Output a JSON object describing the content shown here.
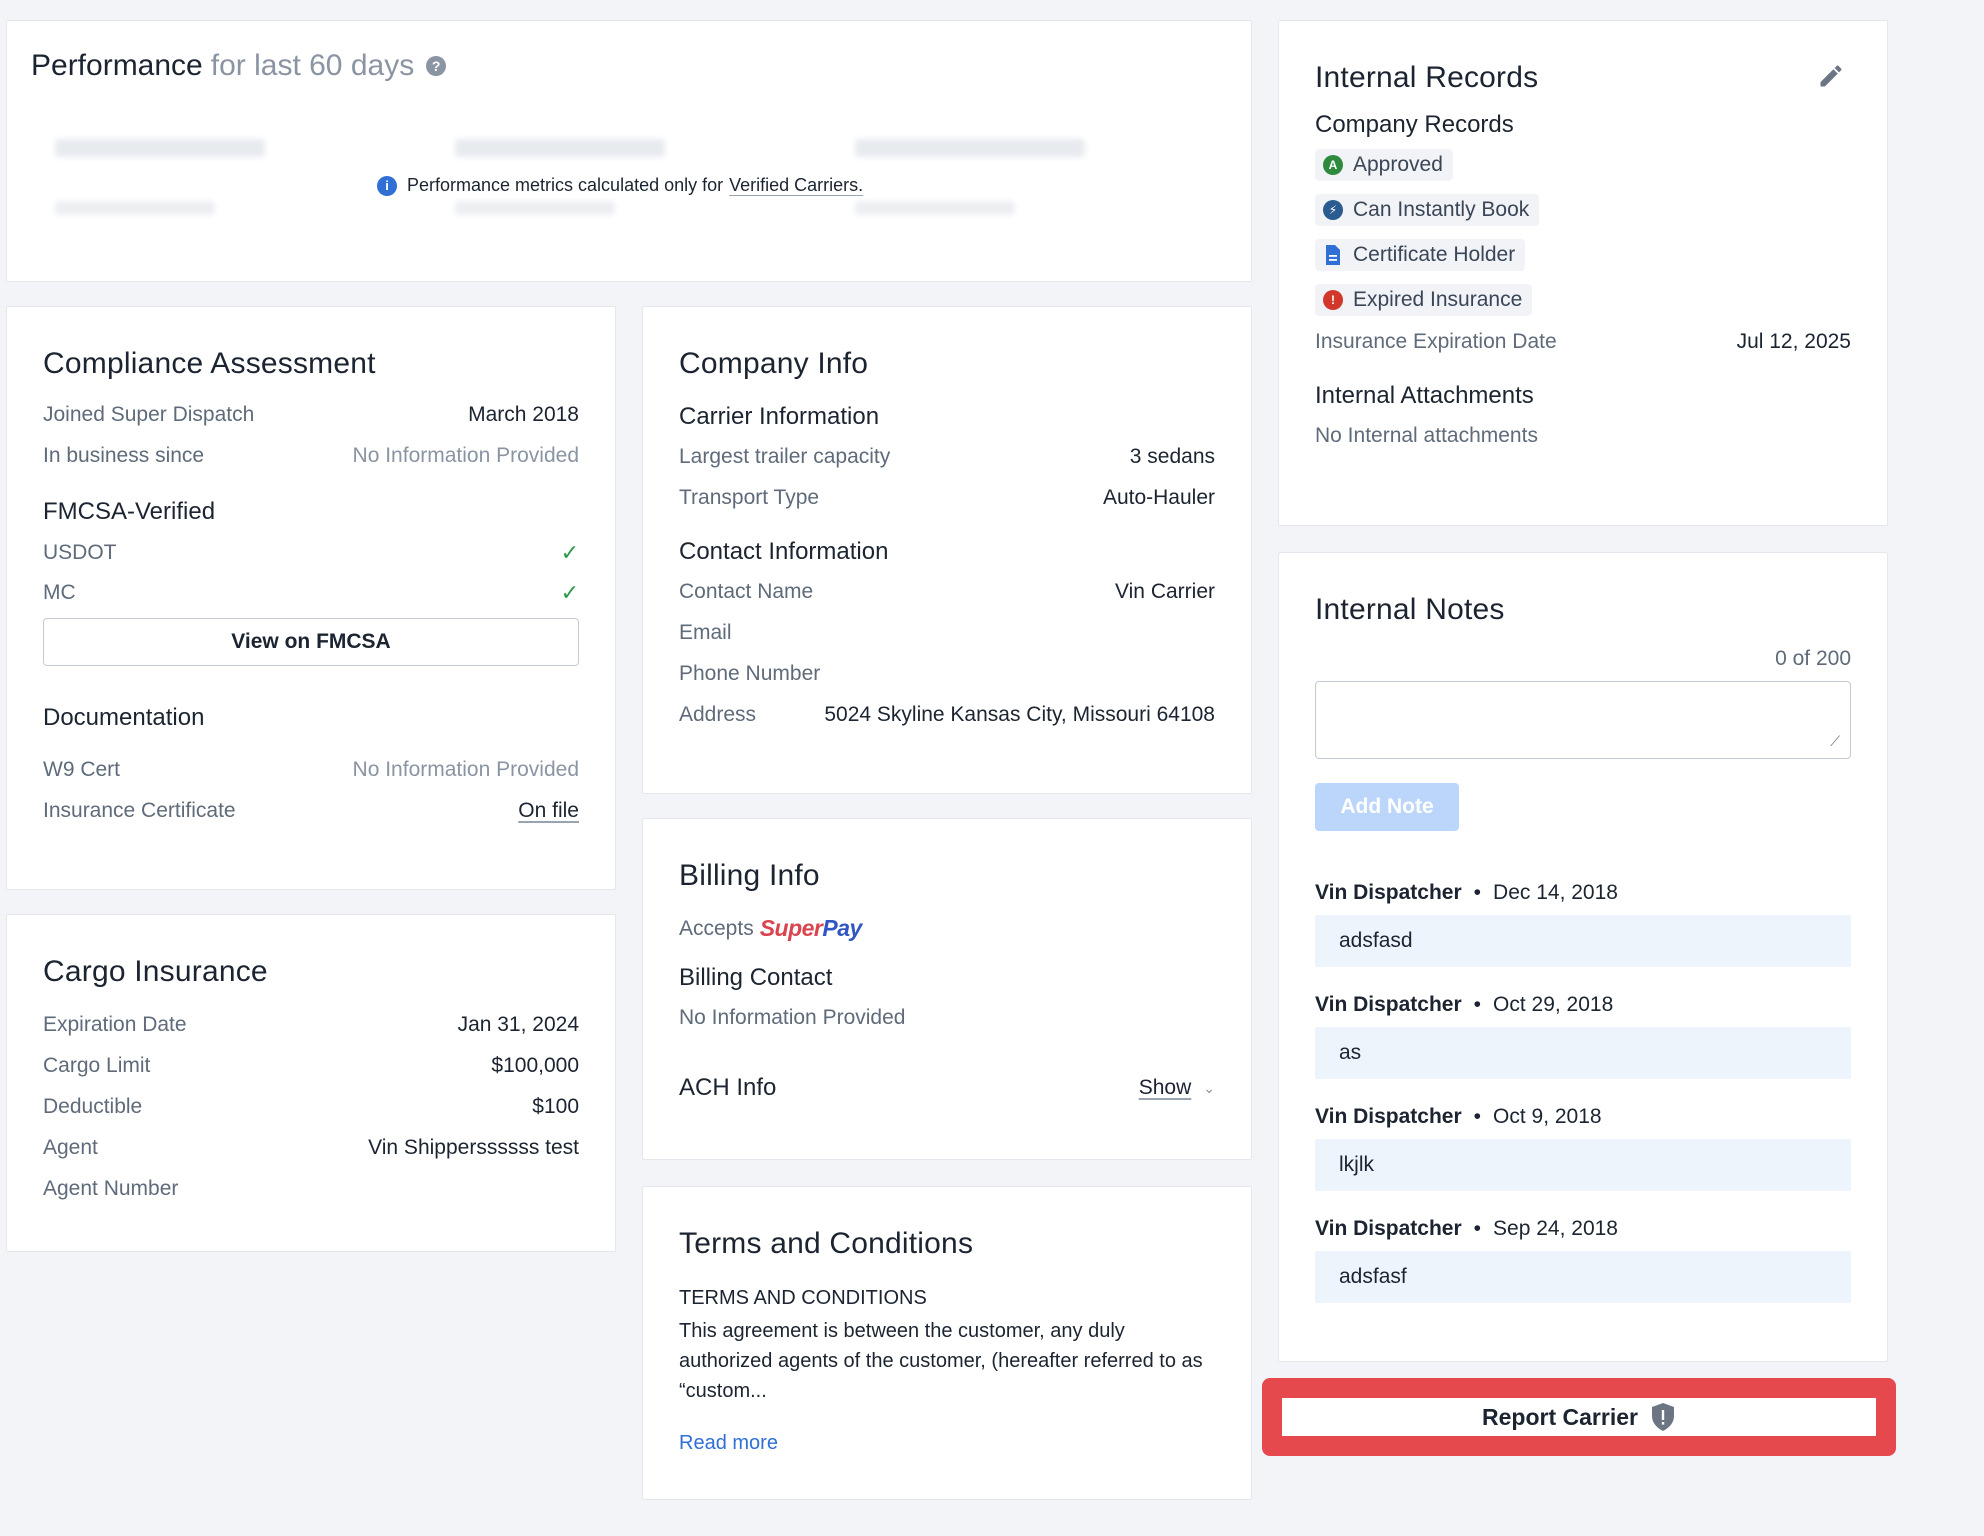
{
  "performance": {
    "title": "Performance",
    "subtitle": "for last 60 days",
    "info_text": "Performance metrics calculated only for",
    "info_link": "Verified Carriers."
  },
  "compliance": {
    "title": "Compliance Assessment",
    "rows": [
      {
        "label": "Joined Super Dispatch",
        "value": "March 2018"
      },
      {
        "label": "In business since",
        "value": "No Information Provided"
      }
    ],
    "fmcsa_title": "FMCSA-Verified",
    "usdot_label": "USDOT",
    "mc_label": "MC",
    "view_button": "View on FMCSA",
    "doc_title": "Documentation",
    "w9_label": "W9 Cert",
    "w9_value": "No Information Provided",
    "ins_label": "Insurance Certificate",
    "ins_value": "On file"
  },
  "cargo": {
    "title": "Cargo Insurance",
    "rows": [
      {
        "label": "Expiration Date",
        "value": "Jan 31, 2024"
      },
      {
        "label": "Cargo Limit",
        "value": "$100,000"
      },
      {
        "label": "Deductible",
        "value": "$100"
      },
      {
        "label": "Agent",
        "value": "Vin Shipperssssss test"
      },
      {
        "label": "Agent Number",
        "value": ""
      }
    ]
  },
  "company": {
    "title": "Company Info",
    "carrier_title": "Carrier Information",
    "carrier_rows": [
      {
        "label": "Largest trailer capacity",
        "value": "3 sedans"
      },
      {
        "label": "Transport Type",
        "value": "Auto-Hauler"
      }
    ],
    "contact_title": "Contact Information",
    "contact_rows": [
      {
        "label": "Contact Name",
        "value": "Vin Carrier"
      },
      {
        "label": "Email",
        "value": ""
      },
      {
        "label": "Phone Number",
        "value": ""
      },
      {
        "label": "Address",
        "value": "5024 Skyline Kansas City, Missouri 64108"
      }
    ]
  },
  "billing": {
    "title": "Billing Info",
    "accepts": "Accepts",
    "superpay_super": "Super",
    "superpay_pay": "Pay",
    "contact_title": "Billing Contact",
    "contact_value": "No Information Provided",
    "ach_title": "ACH Info",
    "ach_show": "Show"
  },
  "terms": {
    "title": "Terms and Conditions",
    "heading": "TERMS AND CONDITIONS",
    "body": "This agreement is between the customer, any duly authorized agents of the customer, (hereafter referred to as “custom...",
    "read_more": "Read more"
  },
  "internal_records": {
    "title": "Internal Records",
    "company_records_title": "Company Records",
    "badges": [
      {
        "label": "Approved",
        "icon": "approved-icon",
        "color": "#2e8b3e"
      },
      {
        "label": "Can Instantly Book",
        "icon": "lightning-icon",
        "color": "#2b5b8f"
      },
      {
        "label": "Certificate Holder",
        "icon": "document-icon",
        "color": "#2f6fd6"
      },
      {
        "label": "Expired Insurance",
        "icon": "alert-icon",
        "color": "#d2372c"
      }
    ],
    "ins_exp_label": "Insurance Expiration Date",
    "ins_exp_value": "Jul 12, 2025",
    "attachments_title": "Internal Attachments",
    "attachments_value": "No Internal attachments"
  },
  "internal_notes": {
    "title": "Internal Notes",
    "counter": "0 of 200",
    "add_button": "Add Note",
    "notes": [
      {
        "author": "Vin Dispatcher",
        "date": "Dec 14, 2018",
        "text": "adsfasd"
      },
      {
        "author": "Vin Dispatcher",
        "date": "Oct 29, 2018",
        "text": "as"
      },
      {
        "author": "Vin Dispatcher",
        "date": "Oct 9, 2018",
        "text": "lkjlk"
      },
      {
        "author": "Vin Dispatcher",
        "date": "Sep 24, 2018",
        "text": "adsfasf"
      }
    ]
  },
  "report": {
    "label": "Report Carrier",
    "highlight_color": "#e5484d"
  }
}
